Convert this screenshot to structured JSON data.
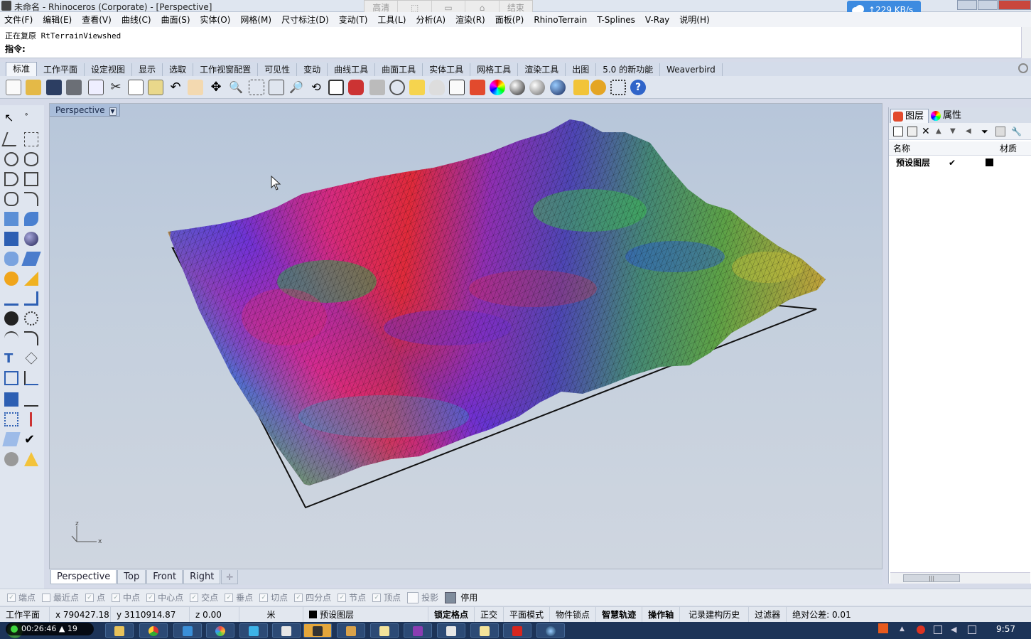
{
  "window": {
    "title": "未命名 - Rhinoceros (Corporate) - [Perspective]",
    "recorder_buttons": [
      "高清",
      "",
      "",
      "",
      "结束"
    ],
    "network_speed": "229 KB/s"
  },
  "menu": [
    "文件(F)",
    "编辑(E)",
    "查看(V)",
    "曲线(C)",
    "曲面(S)",
    "实体(O)",
    "网格(M)",
    "尺寸标注(D)",
    "变动(T)",
    "工具(L)",
    "分析(A)",
    "渲染(R)",
    "面板(P)",
    "RhinoTerrain",
    "T-Splines",
    "V-Ray",
    "说明(H)"
  ],
  "command": {
    "history": "正在复原 RtTerrainViewshed",
    "prompt": "指令:"
  },
  "toolbar_tabs": [
    "标准",
    "工作平面",
    "设定视图",
    "显示",
    "选取",
    "工作视窗配置",
    "可见性",
    "变动",
    "曲线工具",
    "曲面工具",
    "实体工具",
    "网格工具",
    "渲染工具",
    "出图",
    "5.0 的新功能",
    "Weaverbird"
  ],
  "viewport": {
    "label": "Perspective",
    "axis_x": "x",
    "axis_z": "z"
  },
  "viewport_tabs": [
    "Perspective",
    "Top",
    "Front",
    "Right"
  ],
  "right_panel": {
    "tabs": [
      "图层",
      "属性"
    ],
    "columns": [
      "名称",
      "材质"
    ],
    "layers": [
      {
        "name": "预设图层",
        "current": "✔"
      }
    ]
  },
  "osnaps": [
    {
      "label": "端点",
      "checked": true
    },
    {
      "label": "最近点",
      "checked": false
    },
    {
      "label": "点",
      "checked": true
    },
    {
      "label": "中点",
      "checked": true
    },
    {
      "label": "中心点",
      "checked": true
    },
    {
      "label": "交点",
      "checked": true
    },
    {
      "label": "垂点",
      "checked": true
    },
    {
      "label": "切点",
      "checked": true
    },
    {
      "label": "四分点",
      "checked": true
    },
    {
      "label": "节点",
      "checked": true
    },
    {
      "label": "顶点",
      "checked": true
    },
    {
      "label": "投影",
      "checked": false
    }
  ],
  "osnap_disable": "停用",
  "status": {
    "cplane": "工作平面",
    "x": "x 790427.18",
    "y": "y 3110914.87",
    "z": "z 0.00",
    "unit": "米",
    "layer": "预设图层",
    "grid_snap": "锁定格点",
    "ortho": "正交",
    "planar": "平面模式",
    "osnap": "物件锁点",
    "smarttrack": "智慧轨迹",
    "gumball": "操作轴",
    "history": "记录建构历史",
    "filter": "过滤器",
    "tolerance": "绝对公差: 0.01"
  },
  "taskbar": {
    "recording_time": "00:26:46",
    "viewers": "19",
    "clock": "9:57"
  }
}
